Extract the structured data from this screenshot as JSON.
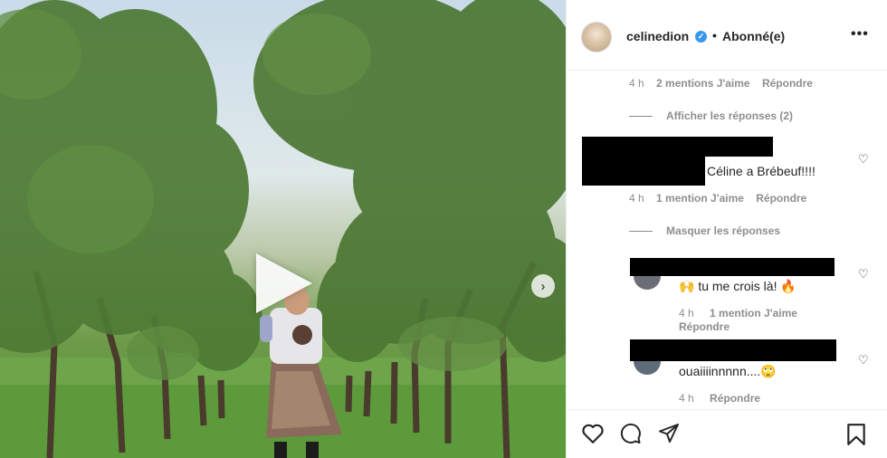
{
  "post": {
    "username": "celinedion",
    "separator": "•",
    "follow_status": "Abonné(e)",
    "more_label": "•••"
  },
  "comments": {
    "c1_meta": {
      "time": "4 h",
      "likes": "2 mentions J'aime",
      "reply": "Répondre"
    },
    "show_replies": "Afficher les réponses (2)",
    "c2_text": "Céline a Brébeuf!!!!",
    "c2_meta": {
      "time": "4 h",
      "likes": "1 mention J'aime",
      "reply": "Répondre"
    },
    "hide_replies": "Masquer les réponses",
    "r1_text": "🙌 tu me crois là! 🔥",
    "r1_meta": {
      "time": "4 h",
      "likes": "1 mention J'aime",
      "reply": "Répondre"
    },
    "r2_text": "ouaiiiinnnnn....🙄",
    "r2_meta": {
      "time": "4 h",
      "reply": "Répondre"
    }
  },
  "media": {
    "next_arrow": "›"
  },
  "icons": {
    "heart": "heart-icon",
    "comment": "comment-icon",
    "share": "share-icon",
    "bookmark": "bookmark-icon",
    "verified": "verified-badge-icon",
    "play": "play-icon"
  },
  "colors": {
    "verified": "#3897f0",
    "muted": "#8e8e8e",
    "text": "#262626"
  }
}
